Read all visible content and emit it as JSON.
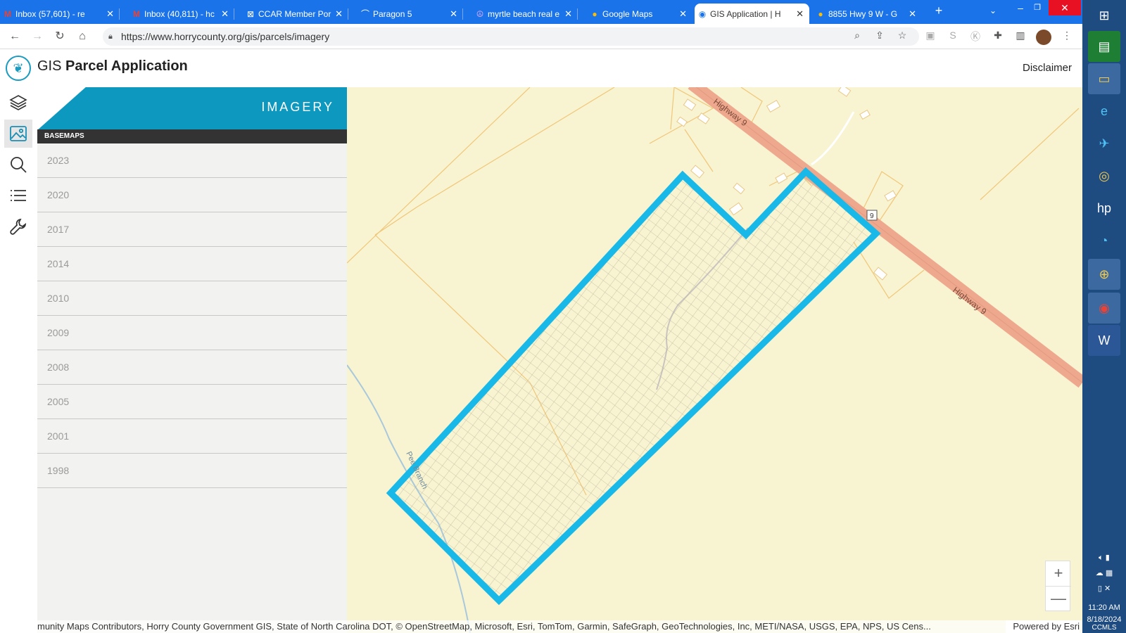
{
  "browser": {
    "tabs": [
      {
        "title": "Inbox (57,601) - re",
        "icon": "gmail-icon"
      },
      {
        "title": "Inbox (40,811) - hc",
        "icon": "gmail-icon"
      },
      {
        "title": "CCAR Member Por",
        "icon": "ccar-icon"
      },
      {
        "title": "Paragon 5",
        "icon": "paragon-icon"
      },
      {
        "title": "myrtle beach real e",
        "icon": "peace-icon"
      },
      {
        "title": "Google Maps",
        "icon": "maps-icon"
      },
      {
        "title": "GIS Application | H",
        "icon": "gis-icon"
      },
      {
        "title": "8855 Hwy 9 W - G",
        "icon": "maps-icon"
      }
    ],
    "url": "https://www.horrycounty.org/gis/parcels/imagery"
  },
  "app": {
    "title_light": "GIS ",
    "title_bold": "Parcel Application",
    "disclaimer": "Disclaimer"
  },
  "panel": {
    "title": "IMAGERY",
    "section": "BASEMAPS",
    "years": [
      "2023",
      "2020",
      "2017",
      "2014",
      "2010",
      "2009",
      "2008",
      "2005",
      "2001",
      "1998"
    ]
  },
  "map": {
    "road_label": "Highway 9",
    "road_label_2": "Highway 9",
    "route_shield": "9",
    "stream_label": "Pee Branch",
    "zoom_in": "+",
    "zoom_out": "—",
    "attribution": "munity Maps Contributors, Horry County Government GIS, State of North Carolina DOT, © OpenStreetMap, Microsoft, Esri, TomTom, Garmin, SafeGraph, GeoTechnologies, Inc, METI/NASA, USGS, EPA, NPS, US Cens...",
    "powered_by": "Powered by Esri",
    "parcel_color": "#18b9e8",
    "road_color": "#eea88d",
    "land_color": "#f8f3d0"
  },
  "system": {
    "time": "11:20 AM",
    "date": "8/18/2024",
    "corner_text": "CCMLS"
  }
}
